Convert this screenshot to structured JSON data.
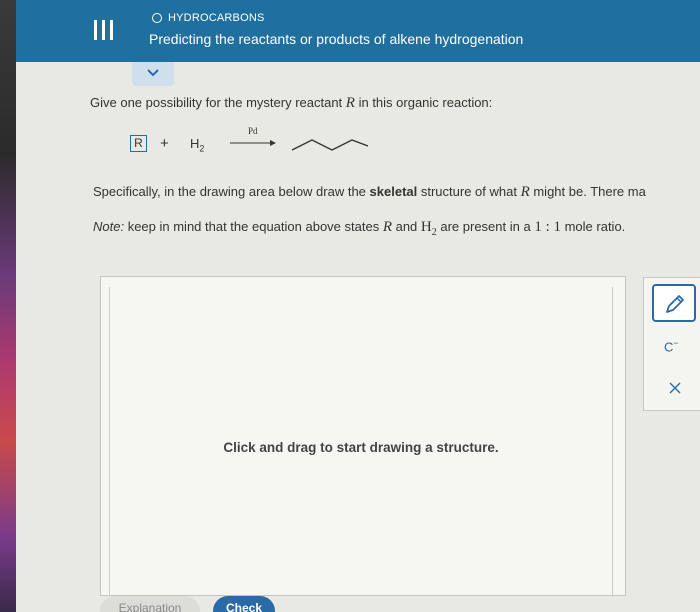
{
  "header": {
    "topic": "HYDROCARBONS",
    "title": "Predicting the reactants or products of alkene hydrogenation",
    "menu_icon": "menu-icon",
    "bg_color": "#1f6f9f"
  },
  "question": {
    "prompt_text": "Give one possibility for the mystery reactant",
    "prompt_var": "R",
    "prompt_end": "in this organic reaction:"
  },
  "reaction": {
    "reactant_box": "R",
    "plus": "+",
    "h2_main": "H",
    "h2_sub": "2",
    "catalyst": "Pd"
  },
  "instructions": {
    "specifically_1": "Specifically, in the drawing area below draw the ",
    "specifically_bold": "skeletal",
    "specifically_2": " structure of what ",
    "specifically_var": "R",
    "specifically_3": " might be. There ma",
    "note_label": "Note:",
    "note_1": " keep in mind that the equation above states ",
    "note_var": "R",
    "note_2": " and ",
    "note_h": "H",
    "note_h_sub": "2",
    "note_3": " are present in a ",
    "note_ratio": "1 : 1",
    "note_4": " mole ratio."
  },
  "drawing_area": {
    "hint": "Click and drag to start drawing a structure."
  },
  "toolbar": {
    "carbanion_label": "C",
    "carbanion_sup": "−"
  },
  "buttons": {
    "explanation": "Explanation",
    "check": "Check"
  }
}
